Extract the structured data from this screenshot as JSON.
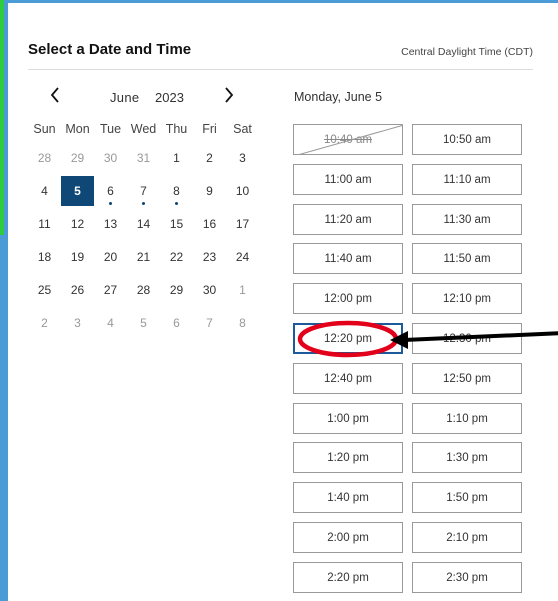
{
  "header": {
    "title": "Select a Date and Time",
    "timezone": "Central Daylight Time (CDT)"
  },
  "calendar": {
    "month": "June",
    "year": "2023",
    "prev_icon": "chevron-left-icon",
    "next_icon": "chevron-right-icon",
    "weekdays": [
      "Sun",
      "Mon",
      "Tue",
      "Wed",
      "Thu",
      "Fri",
      "Sat"
    ],
    "weeks": [
      [
        {
          "d": "28",
          "m": true
        },
        {
          "d": "29",
          "m": true
        },
        {
          "d": "30",
          "m": true
        },
        {
          "d": "31",
          "m": true
        },
        {
          "d": "1"
        },
        {
          "d": "2"
        },
        {
          "d": "3"
        }
      ],
      [
        {
          "d": "4"
        },
        {
          "d": "5",
          "sel": true
        },
        {
          "d": "6",
          "dot": true
        },
        {
          "d": "7",
          "dot": true
        },
        {
          "d": "8",
          "dot": true
        },
        {
          "d": "9"
        },
        {
          "d": "10"
        }
      ],
      [
        {
          "d": "11"
        },
        {
          "d": "12"
        },
        {
          "d": "13"
        },
        {
          "d": "14"
        },
        {
          "d": "15"
        },
        {
          "d": "16"
        },
        {
          "d": "17"
        }
      ],
      [
        {
          "d": "18"
        },
        {
          "d": "19"
        },
        {
          "d": "20"
        },
        {
          "d": "21"
        },
        {
          "d": "22"
        },
        {
          "d": "23"
        },
        {
          "d": "24"
        }
      ],
      [
        {
          "d": "25"
        },
        {
          "d": "26"
        },
        {
          "d": "27"
        },
        {
          "d": "28"
        },
        {
          "d": "29"
        },
        {
          "d": "30"
        },
        {
          "d": "1",
          "m": true
        }
      ],
      [
        {
          "d": "2",
          "m": true
        },
        {
          "d": "3",
          "m": true
        },
        {
          "d": "4",
          "m": true
        },
        {
          "d": "5",
          "m": true
        },
        {
          "d": "6",
          "m": true
        },
        {
          "d": "7",
          "m": true
        },
        {
          "d": "8",
          "m": true
        }
      ]
    ],
    "selected_color": "#0f4777"
  },
  "slots": {
    "date_heading": "Monday, June 5",
    "left": [
      "10:40 am",
      "11:00 am",
      "11:20 am",
      "11:40 am",
      "12:00 pm",
      "12:20 pm",
      "12:40 pm",
      "1:00 pm",
      "1:20 pm",
      "1:40 pm",
      "2:00 pm",
      "2:20 pm"
    ],
    "right": [
      "10:50 am",
      "11:10 am",
      "11:30 am",
      "11:50 am",
      "12:10 pm",
      "12:30 pm",
      "12:50 pm",
      "1:10 pm",
      "1:30 pm",
      "1:50 pm",
      "2:10 pm",
      "2:30 pm"
    ],
    "unavailable": "10:40 am",
    "highlighted": "12:20 pm"
  },
  "annotation": {
    "circle_color": "#e3001b",
    "arrow_color": "#000000"
  }
}
